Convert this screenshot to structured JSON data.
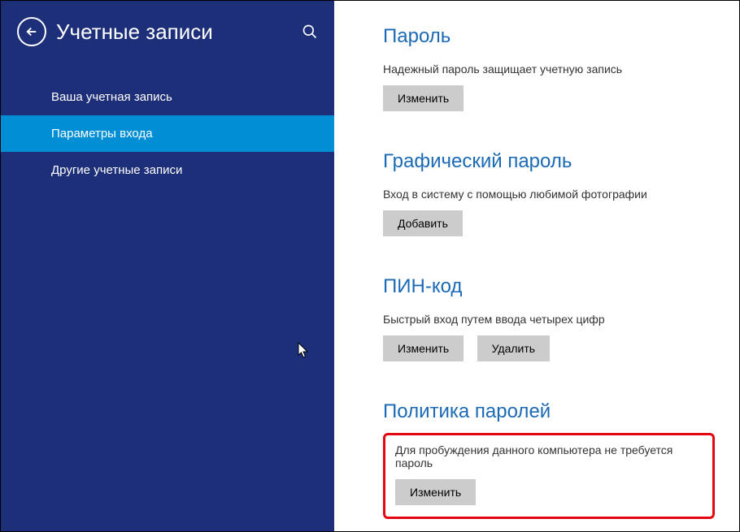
{
  "sidebar": {
    "title": "Учетные записи",
    "items": [
      {
        "label": "Ваша учетная запись",
        "active": false
      },
      {
        "label": "Параметры входа",
        "active": true
      },
      {
        "label": "Другие учетные записи",
        "active": false
      }
    ]
  },
  "sections": {
    "password": {
      "title": "Пароль",
      "desc": "Надежный пароль защищает учетную запись",
      "change_btn": "Изменить"
    },
    "picture_password": {
      "title": "Графический пароль",
      "desc": "Вход в систему с помощью любимой фотографии",
      "add_btn": "Добавить"
    },
    "pin": {
      "title": "ПИН-код",
      "desc": "Быстрый вход путем ввода четырех цифр",
      "change_btn": "Изменить",
      "delete_btn": "Удалить"
    },
    "policy": {
      "title": "Политика паролей",
      "desc": "Для пробуждения данного компьютера не требуется пароль",
      "change_btn": "Изменить"
    }
  }
}
